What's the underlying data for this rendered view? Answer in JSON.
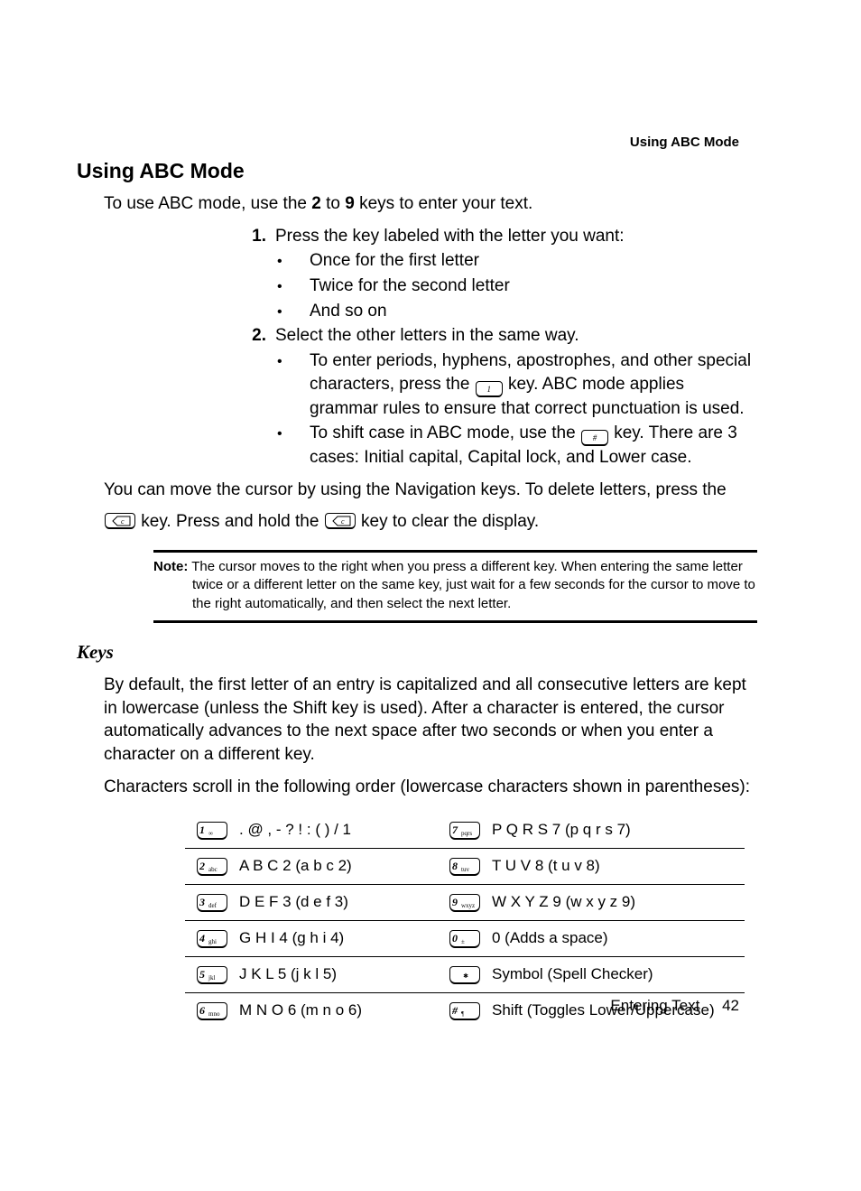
{
  "header_right": "Using ABC Mode",
  "h1": "Using ABC Mode",
  "intro_pre": "To use ABC mode, use the ",
  "intro_b1": "2",
  "intro_mid": " to ",
  "intro_b2": "9",
  "intro_post": " keys to enter your text.",
  "step1_num": "1.",
  "step1_text": "Press the key labeled with the letter you want:",
  "s1b": [
    "Once for the first letter",
    "Twice for the second letter",
    "And so on"
  ],
  "step2_num": "2.",
  "step2_text": "Select the other letters in the same way.",
  "s2b1_pre": "To enter periods, hyphens, apostrophes, and other special characters, press the ",
  "s2b1_key": "1 ",
  "s2b1_post": " key. ABC mode applies grammar rules to ensure that correct punctuation is used.",
  "s2b2_pre": "To shift case in ABC mode, use the ",
  "s2b2_key": "# ",
  "s2b2_post": " key. There are 3 cases: Initial capital, Capital lock, and Lower case.",
  "para_move_a": "You can move the cursor by using the Navigation keys. To delete letters, press the",
  "para_move_b_mid": " key. Press and hold the ",
  "para_move_b_post": " key to clear the display.",
  "note_label": "Note:",
  "note_text": " The cursor moves to the right when you press a different key. When entering the same letter twice or a different letter on the same key, just wait for a few seconds for the cursor to move to the right automatically, and then select the next letter.",
  "h2": "Keys",
  "keys_p1": "By default, the first letter of an entry is capitalized and all consecutive letters are kept in lowercase (unless the Shift key is used). After a character is entered, the cursor automatically advances to the next space after two seconds or when you enter a character on a different key.",
  "keys_p2": "Characters scroll in the following order (lowercase characters shown in parentheses):",
  "table": [
    {
      "lkey_big": "1",
      "lkey_sub": "∞",
      "ltext": ". @ , - ? ! : ( ) / 1",
      "rkey_big": "7",
      "rkey_sub": "pqrs",
      "rtext": "P Q R S 7 (p q r s 7)"
    },
    {
      "lkey_big": "2",
      "lkey_sub": "abc",
      "ltext": "A B C 2 (a b c 2)",
      "rkey_big": "8",
      "rkey_sub": "tuv",
      "rtext": "T U V 8 (t u v 8)"
    },
    {
      "lkey_big": "3",
      "lkey_sub": "def",
      "ltext": "D E F 3 (d e f 3)",
      "rkey_big": "9",
      "rkey_sub": "wxyz",
      "rtext": "W X Y Z 9 (w x y z 9)"
    },
    {
      "lkey_big": "4",
      "lkey_sub": "ghi",
      "ltext": "G H I 4 (g h i 4)",
      "rkey_big": "0",
      "rkey_sub": "±",
      "rtext": "0 (Adds a space)"
    },
    {
      "lkey_big": "5",
      "lkey_sub": "jkl",
      "ltext": "J K L 5 (j k l 5)",
      "rkey_big": "",
      "rkey_sub": "✱",
      "rtext": "Symbol (Spell Checker)"
    },
    {
      "lkey_big": "6",
      "lkey_sub": "mno",
      "ltext": "M N O 6 (m n o 6)",
      "rkey_big": "#",
      "rkey_sub": "¶",
      "rtext": "Shift (Toggles Lower/Uppercase)"
    }
  ],
  "footer_section": "Entering Text",
  "footer_page": "42"
}
